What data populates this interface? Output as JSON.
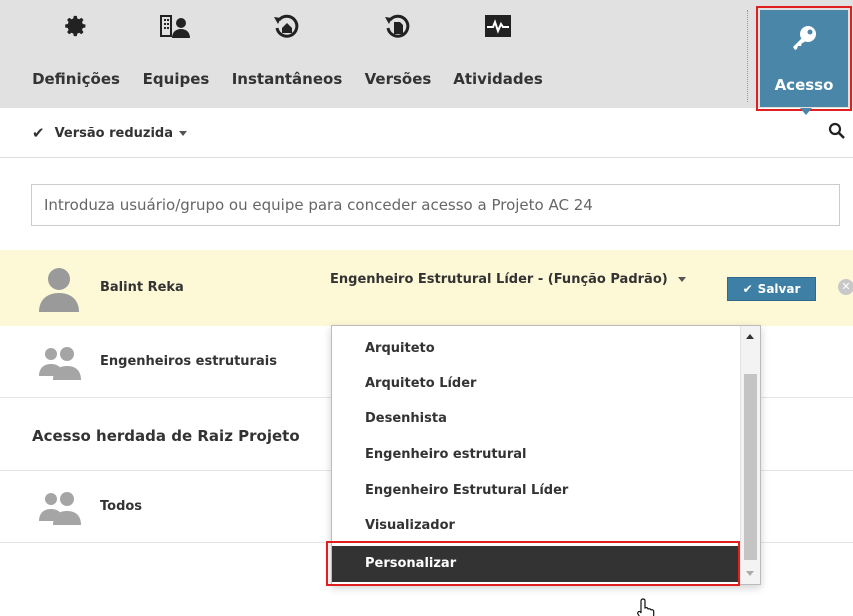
{
  "toolbar": {
    "items": [
      {
        "label": "Definições",
        "icon": "gear-icon"
      },
      {
        "label": "Equipes",
        "icon": "teams-icon"
      },
      {
        "label": "Instantâneos",
        "icon": "snapshot-icon"
      },
      {
        "label": "Versões",
        "icon": "versions-icon"
      },
      {
        "label": "Atividades",
        "icon": "activity-icon"
      }
    ],
    "access": {
      "label": "Acesso",
      "icon": "key-icon"
    }
  },
  "subbar": {
    "view_label": "Versão reduzida",
    "search_icon": "search-icon"
  },
  "access_input": {
    "placeholder": "Introduza usuário/grupo ou equipe para conceder acesso a Projeto AC 24"
  },
  "members": [
    {
      "name": "Balint Reka",
      "role": "Engenheiro Estrutural Líder - (Função Padrão)",
      "save_label": "Salvar"
    },
    {
      "name": "Engenheiros estruturais"
    }
  ],
  "inherited": {
    "heading": "Acesso herdada de Raiz Projeto",
    "items": [
      {
        "name": "Todos"
      }
    ]
  },
  "role_dropdown": {
    "options": [
      "Arquiteto",
      "Arquiteto Líder",
      "Desenhista",
      "Engenheiro estrutural",
      "Engenheiro Estrutural Líder",
      "Visualizador",
      "Personalizar"
    ],
    "selected": "Personalizar"
  },
  "colors": {
    "toolbar_bg": "#e1e1e1",
    "accent": "#4a86a8",
    "highlight_row": "#fdf8d6",
    "annotation_red": "#e02020",
    "selected_item": "#333333"
  }
}
